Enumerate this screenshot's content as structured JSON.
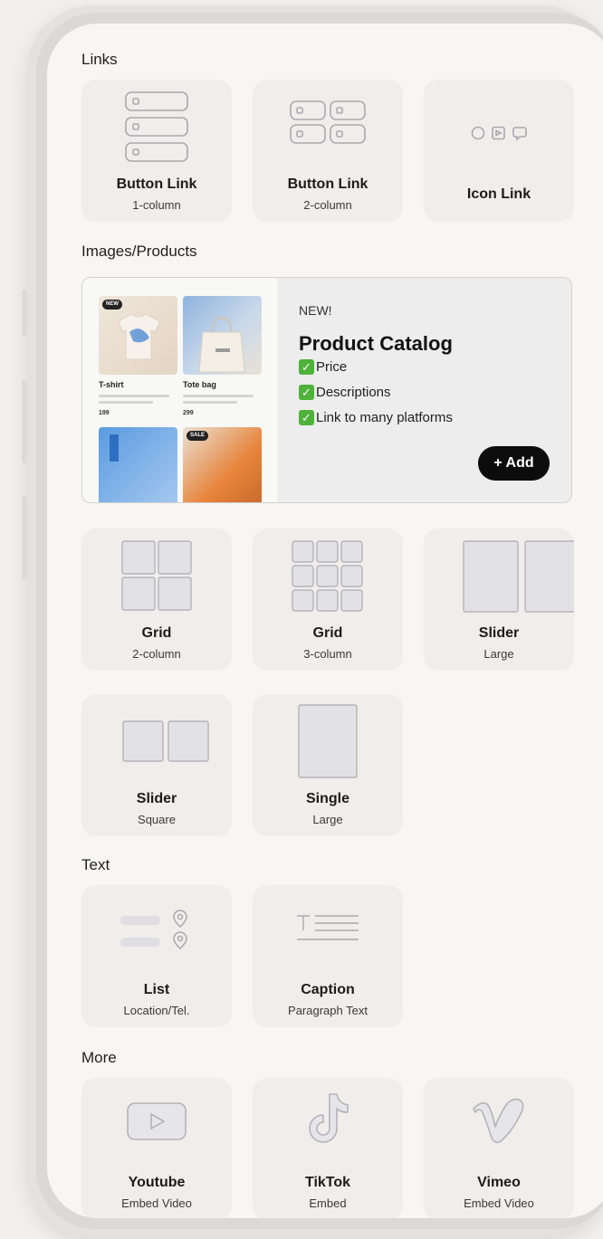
{
  "sections": {
    "links": "Links",
    "images": "Images/Products",
    "text": "Text",
    "more": "More"
  },
  "links_tiles": [
    {
      "title": "Button Link",
      "subtitle": "1-column"
    },
    {
      "title": "Button Link",
      "subtitle": "2-column"
    },
    {
      "title": "Icon Link",
      "subtitle": ""
    }
  ],
  "product_catalog": {
    "badge": "NEW!",
    "title": "Product Catalog",
    "features": [
      "Price",
      "Descriptions",
      "Link to many platforms"
    ],
    "add_label": "+ Add",
    "preview": {
      "item1_name": "T-shirt",
      "item1_price": "199",
      "item2_name": "Tote bag",
      "item2_price": "299",
      "new_badge": "NEW",
      "sale_badge": "SALE"
    }
  },
  "image_tiles": [
    {
      "title": "Grid",
      "subtitle": "2-column"
    },
    {
      "title": "Grid",
      "subtitle": "3-column"
    },
    {
      "title": "Slider",
      "subtitle": "Large"
    },
    {
      "title": "Slider",
      "subtitle": "Square"
    },
    {
      "title": "Single",
      "subtitle": "Large"
    }
  ],
  "text_tiles": [
    {
      "title": "List",
      "subtitle": "Location/Tel."
    },
    {
      "title": "Caption",
      "subtitle": "Paragraph Text"
    }
  ],
  "more_tiles": [
    {
      "title": "Youtube",
      "subtitle": "Embed Video"
    },
    {
      "title": "TikTok",
      "subtitle": "Embed"
    },
    {
      "title": "Vimeo",
      "subtitle": "Embed Video"
    }
  ],
  "colors": {
    "background": "#f1f0ec",
    "screen": "#f7f6f2",
    "tile": "#efeeea",
    "icon_stroke": "#a9a9b0",
    "accent_black": "#0c0c0c",
    "check_green": "#4fb23a"
  }
}
